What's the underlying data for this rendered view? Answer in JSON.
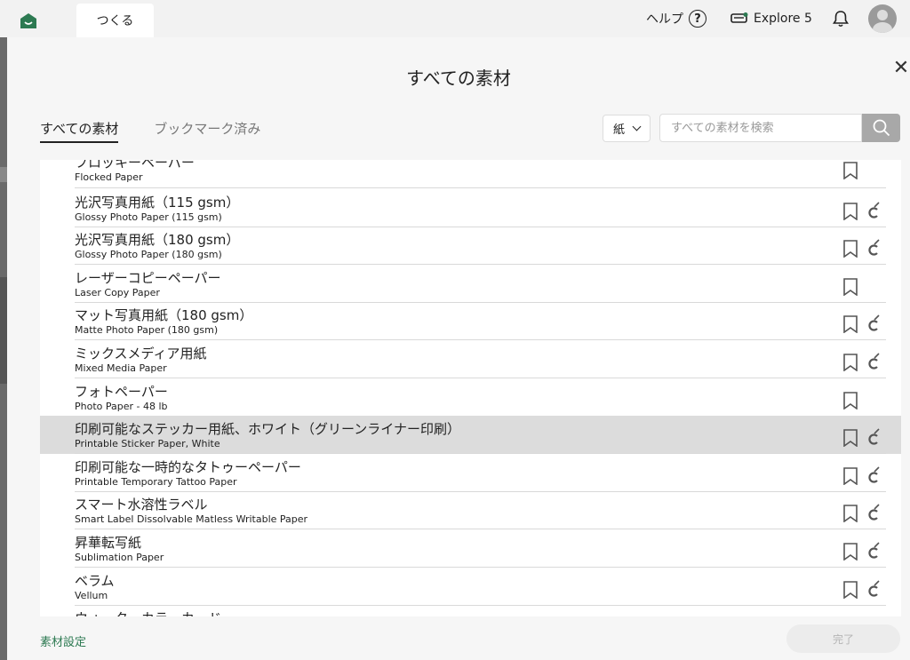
{
  "topbar": {
    "make_tab_label": "つくる",
    "help_label": "ヘルプ",
    "help_icon_glyph": "?",
    "machine_label": "Explore 5",
    "accent_color": "#2d7a52"
  },
  "modal": {
    "title": "すべての素材",
    "close_glyph": "✕",
    "tabs": [
      {
        "label": "すべての素材",
        "active": true
      },
      {
        "label": "ブックマーク済み",
        "active": false
      }
    ],
    "filter_value": "紙",
    "search_placeholder": "すべての素材を検索"
  },
  "materials": [
    {
      "jp": "フロッキーペーパー",
      "en": "Flocked Paper",
      "calibration": false,
      "selected": false
    },
    {
      "jp": "光沢写真用紙（115 gsm）",
      "en": "Glossy Photo Paper (115 gsm)",
      "calibration": true,
      "selected": false
    },
    {
      "jp": "光沢写真用紙（180 gsm）",
      "en": "Glossy Photo Paper (180 gsm)",
      "calibration": true,
      "selected": false
    },
    {
      "jp": "レーザーコピーペーパー",
      "en": "Laser Copy Paper",
      "calibration": false,
      "selected": false
    },
    {
      "jp": "マット写真用紙（180 gsm）",
      "en": "Matte Photo Paper (180 gsm)",
      "calibration": true,
      "selected": false
    },
    {
      "jp": "ミックスメディア用紙",
      "en": "Mixed Media Paper",
      "calibration": true,
      "selected": false
    },
    {
      "jp": "フォトペーパー",
      "en": "Photo Paper - 48 lb",
      "calibration": false,
      "selected": false
    },
    {
      "jp": "印刷可能なステッカー用紙、ホワイト（グリーンライナー印刷）",
      "en": "Printable Sticker Paper, White",
      "calibration": true,
      "selected": true
    },
    {
      "jp": "印刷可能な一時的なタトゥーペーパー",
      "en": "Printable Temporary Tattoo Paper",
      "calibration": true,
      "selected": false
    },
    {
      "jp": "スマート水溶性ラベル",
      "en": "Smart Label Dissolvable Matless Writable Paper",
      "calibration": true,
      "selected": false
    },
    {
      "jp": "昇華転写紙",
      "en": "Sublimation Paper",
      "calibration": true,
      "selected": false
    },
    {
      "jp": "ベラム",
      "en": "Vellum",
      "calibration": true,
      "selected": false
    },
    {
      "jp": "ウォーターカラーカード",
      "en": "",
      "calibration": true,
      "selected": false
    }
  ],
  "footer": {
    "settings_label": "素材設定",
    "done_label": "完了"
  },
  "icons": {
    "home": "home-icon",
    "help": "help-circle-icon",
    "machine": "machine-icon",
    "bell": "bell-icon",
    "avatar": "avatar",
    "close": "close-icon",
    "chevron": "chevron-down-icon",
    "search": "search-icon",
    "bookmark": "bookmark-icon",
    "calibration": "calibration-icon"
  }
}
